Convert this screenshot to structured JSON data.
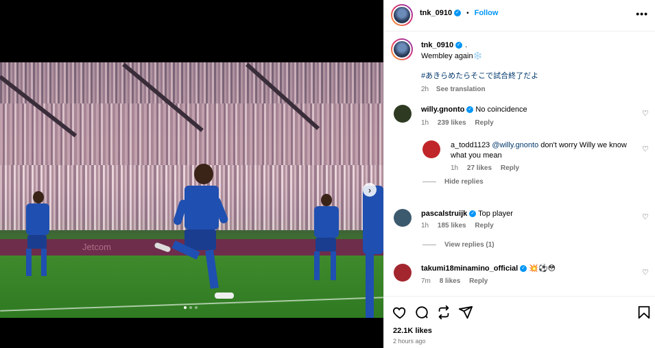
{
  "media": {
    "board_text": "Jetcom",
    "next_icon": "chevron-right-icon",
    "carousel_count": 3,
    "carousel_active": 1
  },
  "header": {
    "username": "tnk_0910",
    "separator": "•",
    "follow_label": "Follow",
    "more_icon": "ellipsis-icon",
    "more_glyph": "•••"
  },
  "caption": {
    "username": "tnk_0910",
    "suffix": ".",
    "text": "Wembley again❄️",
    "hashtag": "#あきらめたらそこで試合終了だよ",
    "time": "2h",
    "see_translation": "See translation"
  },
  "comments": [
    {
      "username": "willy.gnonto",
      "text": "No coincidence",
      "time": "1h",
      "likes": "239 likes",
      "reply": "Reply",
      "avatar_color": "#2e3b22"
    },
    {
      "username": "a_todd1123",
      "mention": "@willy.gnonto",
      "text": " don't worry Willy we know what you mean",
      "time": "1h",
      "likes": "27 likes",
      "reply": "Reply",
      "avatar_color": "#c0252a"
    },
    {
      "username": "pascalstruijk",
      "text": "Top player",
      "time": "1h",
      "likes": "185 likes",
      "reply": "Reply",
      "avatar_color": "#3c5a6e"
    },
    {
      "username": "takumi18minamino_official",
      "text": "💥⚽😳",
      "time": "7m",
      "likes": "8 likes",
      "reply": "Reply",
      "avatar_color": "#a3262e"
    }
  ],
  "hide_replies": "Hide replies",
  "view_replies": "View replies (1)",
  "actions": {
    "like_icon": "heart-icon",
    "comment_icon": "comment-icon",
    "repost_icon": "repost-icon",
    "share_icon": "share-icon",
    "save_icon": "bookmark-icon",
    "likes": "22.1K likes",
    "ago": "2 hours ago"
  },
  "colors": {
    "accent": "#0095f6",
    "link": "#00376b",
    "muted": "#737373"
  }
}
